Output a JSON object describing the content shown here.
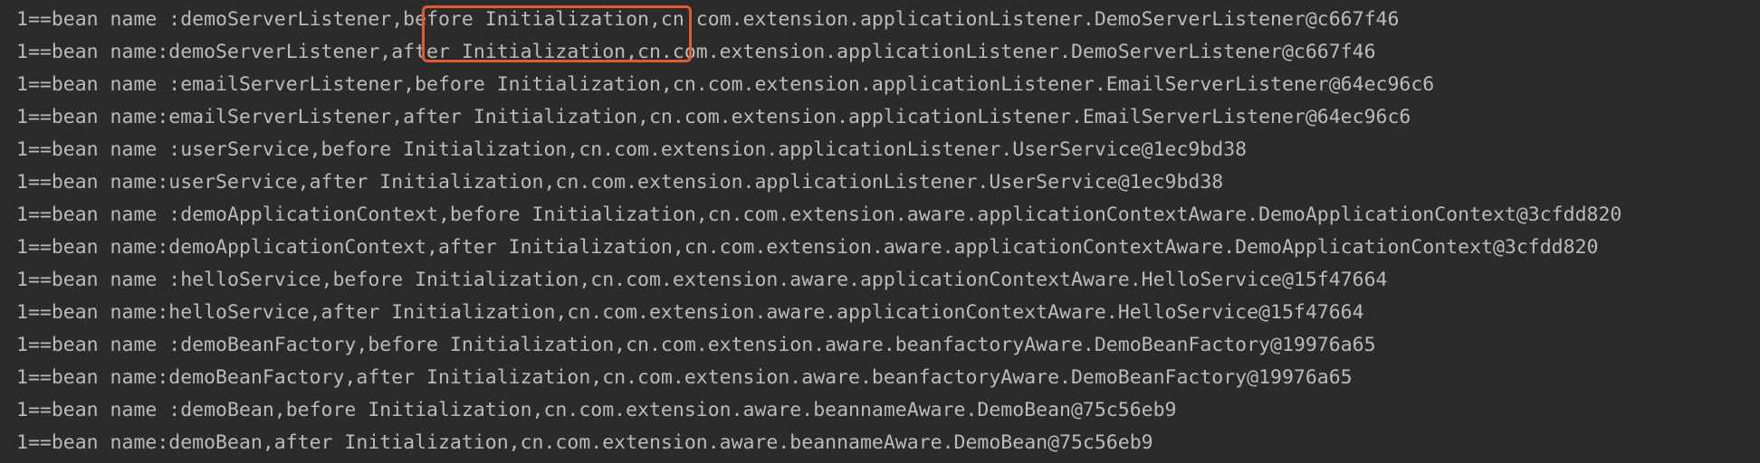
{
  "console": {
    "lines": [
      "1==bean name :demoServerListener,before Initialization,cn.com.extension.applicationListener.DemoServerListener@c667f46",
      "1==bean name:demoServerListener,after Initialization,cn.com.extension.applicationListener.DemoServerListener@c667f46",
      "1==bean name :emailServerListener,before Initialization,cn.com.extension.applicationListener.EmailServerListener@64ec96c6",
      "1==bean name:emailServerListener,after Initialization,cn.com.extension.applicationListener.EmailServerListener@64ec96c6",
      "1==bean name :userService,before Initialization,cn.com.extension.applicationListener.UserService@1ec9bd38",
      "1==bean name:userService,after Initialization,cn.com.extension.applicationListener.UserService@1ec9bd38",
      "1==bean name :demoApplicationContext,before Initialization,cn.com.extension.aware.applicationContextAware.DemoApplicationContext@3cfdd820",
      "1==bean name:demoApplicationContext,after Initialization,cn.com.extension.aware.applicationContextAware.DemoApplicationContext@3cfdd820",
      "1==bean name :helloService,before Initialization,cn.com.extension.aware.applicationContextAware.HelloService@15f47664",
      "1==bean name:helloService,after Initialization,cn.com.extension.aware.applicationContextAware.HelloService@15f47664",
      "1==bean name :demoBeanFactory,before Initialization,cn.com.extension.aware.beanfactoryAware.DemoBeanFactory@19976a65",
      "1==bean name:demoBeanFactory,after Initialization,cn.com.extension.aware.beanfactoryAware.DemoBeanFactory@19976a65",
      "1==bean name :demoBean,before Initialization,cn.com.extension.aware.beannameAware.DemoBean@75c56eb9",
      "1==bean name:demoBean,after Initialization,cn.com.extension.aware.beannameAware.DemoBean@75c56eb9"
    ]
  },
  "colors": {
    "background": "#2b2b2b",
    "text": "#bbbbbb",
    "highlight": "#e25a33"
  }
}
